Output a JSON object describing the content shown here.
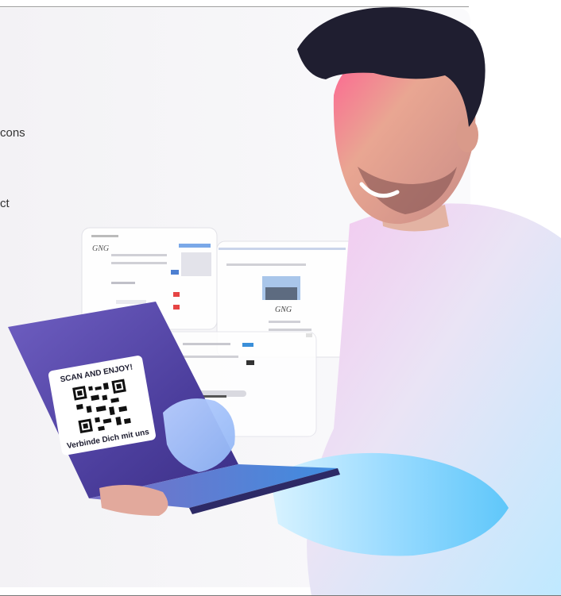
{
  "text_fragments": {
    "line_1": "cons",
    "line_2": "ct"
  },
  "screens": {
    "left_logo": "GNG",
    "right_logo": "GNG"
  },
  "qr_card": {
    "heading": "SCAN AND ENJOY!",
    "tagline": "Verbinde Dich mit uns"
  },
  "colors": {
    "backdrop_left": "#f1f0f3",
    "sweater": "#e9e3f4",
    "hair": "#1a1a2a",
    "skin": "#e8a48f",
    "laptop": "#5a4aa8",
    "accent_pink": "#ff2e7a",
    "accent_cyan": "#4fc9ff"
  }
}
